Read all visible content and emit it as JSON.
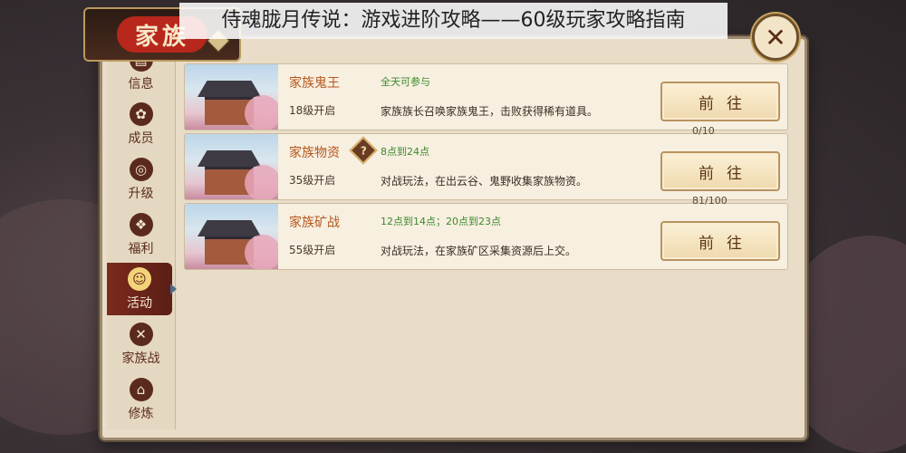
{
  "banner_title": "侍魂胧月传说：游戏进阶攻略——60级玩家攻略指南",
  "title_plate": {
    "text": "家族"
  },
  "close_button": {
    "icon": "x-icon",
    "glyph": "✕"
  },
  "sidebar": {
    "items": [
      {
        "label": "信息",
        "icon": "info-scroll-icon",
        "glyph": "▤"
      },
      {
        "label": "成员",
        "icon": "members-flower-icon",
        "glyph": "✿"
      },
      {
        "label": "升级",
        "icon": "upgrade-icon",
        "glyph": "◎"
      },
      {
        "label": "福利",
        "icon": "gift-icon",
        "glyph": "❖"
      },
      {
        "label": "活动",
        "icon": "activity-face-icon",
        "glyph": "☺",
        "active": true
      },
      {
        "label": "家族战",
        "icon": "crossed-swords-icon",
        "glyph": "✕"
      },
      {
        "label": "修炼",
        "icon": "temple-icon",
        "glyph": "⌂"
      }
    ]
  },
  "activities": [
    {
      "name": "家族鬼王",
      "level": "18级开启",
      "time": "全天可参与",
      "desc": "家族族长召唤家族鬼王，击败获得稀有道具。",
      "progress": "",
      "button": "前往",
      "has_help": false
    },
    {
      "name": "家族物资",
      "level": "35级开启",
      "time": "8点到24点",
      "desc": "对战玩法，在出云谷、鬼野收集家族物资。",
      "progress": "0/10",
      "button": "前往",
      "has_help": true,
      "help_glyph": "?"
    },
    {
      "name": "家族矿战",
      "level": "55级开启",
      "time": "12点到14点；20点到23点",
      "desc": "对战玩法，在家族矿区采集资源后上交。",
      "progress": "81/100",
      "button": "前往",
      "has_help": false
    }
  ]
}
